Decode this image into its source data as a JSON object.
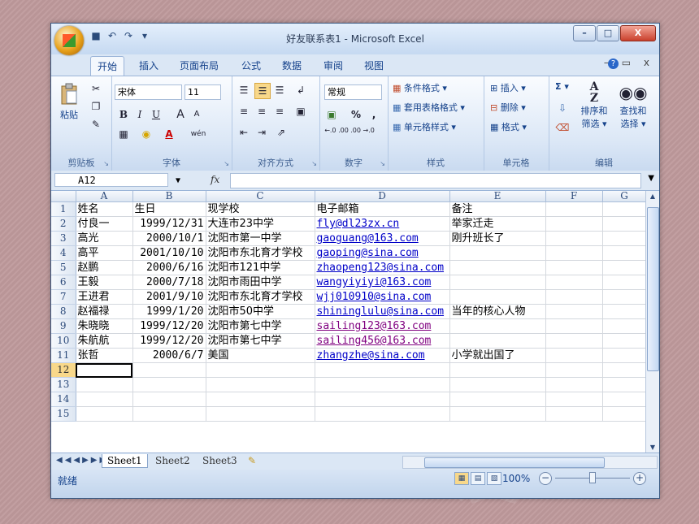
{
  "window": {
    "title": "好友联系表1 - Microsoft Excel"
  },
  "qat_icons": [
    "save-icon",
    "undo-icon",
    "redo-icon",
    "customize-dropdown-icon"
  ],
  "window_controls": {
    "minimize": "–",
    "maximize": "□",
    "close": "X"
  },
  "ribbon_tabs": [
    "开始",
    "插入",
    "页面布局",
    "公式",
    "数据",
    "审阅",
    "视图"
  ],
  "ribbon_right": {
    "help": "?",
    "doc_controls": "– ▭ x"
  },
  "ribbon": {
    "clipboard": {
      "label": "剪贴板",
      "paste": "粘贴"
    },
    "font": {
      "label": "字体",
      "name": "宋体",
      "size": "11",
      "bold": "B",
      "italic": "I",
      "underline": "U",
      "grow": "A",
      "shrink": "A",
      "color": "A",
      "phonetic": "wén"
    },
    "alignment": {
      "label": "对齐方式"
    },
    "number": {
      "label": "数字",
      "format": "常规",
      "percent": "%",
      "comma": ",",
      "inc_dec": "←.0 .00",
      "dec_dec": ".00 →.0"
    },
    "styles": {
      "label": "样式",
      "conditional": "条件格式 ▾",
      "table": "套用表格格式 ▾",
      "cell": "单元格样式 ▾"
    },
    "cells": {
      "label": "单元格",
      "insert": "插入 ▾",
      "delete": "删除 ▾",
      "format": "格式 ▾"
    },
    "editing": {
      "label": "编辑",
      "sum": "Σ ▾",
      "sort": "排序和",
      "sort2": "筛选 ▾",
      "find": "查找和",
      "find2": "选择 ▾"
    }
  },
  "formula_bar": {
    "name_box": "A12",
    "fx": "fx",
    "value": ""
  },
  "sheet": {
    "columns": [
      "A",
      "B",
      "C",
      "D",
      "E",
      "F",
      "G"
    ],
    "rows": [
      {
        "n": "1",
        "a": "姓名",
        "b": "生日",
        "c": "现学校",
        "d": "电子邮箱",
        "e": "备注"
      },
      {
        "n": "2",
        "a": "付良一",
        "b": "1999/12/31",
        "c": "大连市23中学",
        "d": "fly@dl23zx.cn",
        "e": "举家迁走"
      },
      {
        "n": "3",
        "a": "高光",
        "b": "2000/10/1",
        "c": "沈阳市第一中学",
        "d": "gaoguang@163.com",
        "e": "刚升班长了"
      },
      {
        "n": "4",
        "a": "高平",
        "b": "2001/10/10",
        "c": "沈阳市东北育才学校",
        "d": "gaoping@sina.com",
        "e": ""
      },
      {
        "n": "5",
        "a": "赵鹏",
        "b": "2000/6/16",
        "c": "沈阳市121中学",
        "d": "zhaopeng123@sina.com",
        "e": ""
      },
      {
        "n": "6",
        "a": "王毅",
        "b": "2000/7/18",
        "c": "沈阳市雨田中学",
        "d": "wangyiyiyi@163.com",
        "e": ""
      },
      {
        "n": "7",
        "a": "王进君",
        "b": "2001/9/10",
        "c": "沈阳市东北育才学校",
        "d": "wjj010910@sina.com",
        "e": ""
      },
      {
        "n": "8",
        "a": "赵福禄",
        "b": "1999/1/20",
        "c": "沈阳市50中学",
        "d": "shininglulu@sina.com",
        "e": "当年的核心人物"
      },
      {
        "n": "9",
        "a": "朱晓晓",
        "b": "1999/12/20",
        "c": "沈阳市第七中学",
        "d": "sailing123@163.com",
        "e": ""
      },
      {
        "n": "10",
        "a": "朱航航",
        "b": "1999/12/20",
        "c": "沈阳市第七中学",
        "d": "sailing456@163.com",
        "e": ""
      },
      {
        "n": "11",
        "a": "张哲",
        "b": "2000/6/7",
        "c": "美国",
        "d": "zhangzhe@sina.com",
        "e": "小学就出国了"
      },
      {
        "n": "12",
        "a": "",
        "b": "",
        "c": "",
        "d": "",
        "e": ""
      },
      {
        "n": "13",
        "a": "",
        "b": "",
        "c": "",
        "d": "",
        "e": ""
      },
      {
        "n": "14",
        "a": "",
        "b": "",
        "c": "",
        "d": "",
        "e": ""
      },
      {
        "n": "15",
        "a": "",
        "b": "",
        "c": "",
        "d": "",
        "e": ""
      }
    ]
  },
  "sheet_tabs": [
    "Sheet1",
    "Sheet2",
    "Sheet3"
  ],
  "status": {
    "ready": "就绪",
    "zoom": "100%"
  },
  "colors": {
    "link": "#0000c8",
    "visited_link": "#800080",
    "ribbon_text": "#15428b"
  }
}
